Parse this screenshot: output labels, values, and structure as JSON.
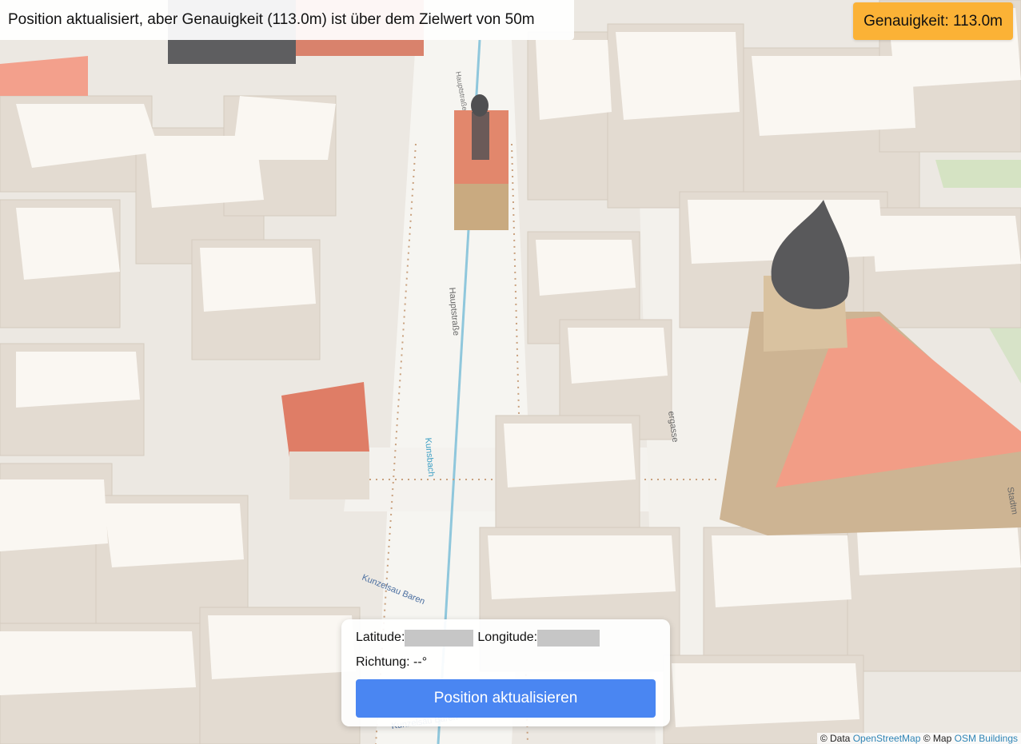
{
  "status": {
    "message": "Position aktualisiert, aber Genauigkeit (113.0m) ist über dem Zielwert von 50m"
  },
  "accuracy_badge": {
    "label": "Genauigkeit: 113.0m",
    "color": "#fbb236"
  },
  "info_panel": {
    "latitude_label": "Latitude:",
    "longitude_label": "Longitude:",
    "heading_label": "Richtung: --°",
    "update_button_label": "Position aktualisieren",
    "button_color": "#4a86f2"
  },
  "attribution": {
    "prefix": "© Data",
    "osm_link": "OpenStreetMap",
    "middle": "© Map",
    "buildings_link": "OSM Buildings"
  },
  "map": {
    "street_labels": [
      "Hauptstraße",
      "Hauptstraße",
      "Kunsbach",
      "Kunzelsau Baren",
      "Kunzelsau Baren",
      "ergasse",
      "Stadtm"
    ]
  }
}
